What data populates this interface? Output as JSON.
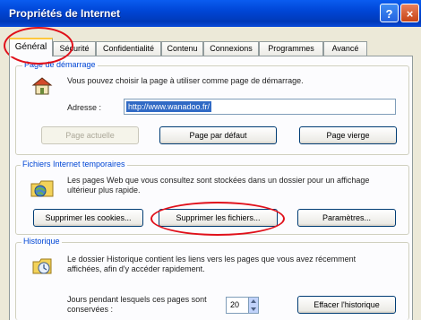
{
  "window": {
    "title": "Propriétés de Internet",
    "help_label": "?",
    "close_label": "×"
  },
  "tabs": [
    {
      "label": "Général",
      "active": true
    },
    {
      "label": "Sécurité"
    },
    {
      "label": "Confidentialité"
    },
    {
      "label": "Contenu"
    },
    {
      "label": "Connexions"
    },
    {
      "label": "Programmes"
    },
    {
      "label": "Avancé"
    }
  ],
  "homepage": {
    "legend": "Page de démarrage",
    "description": "Vous pouvez choisir la page à utiliser comme page de démarrage.",
    "address_label": "Adresse :",
    "address_value": "http://www.wanadoo.fr/",
    "btn_current": "Page actuelle",
    "btn_default": "Page par défaut",
    "btn_blank": "Page vierge"
  },
  "temp_files": {
    "legend": "Fichiers Internet temporaires",
    "description": "Les pages Web que vous consultez sont stockées dans un dossier pour un affichage ultérieur plus rapide.",
    "btn_cookies": "Supprimer les cookies...",
    "btn_files": "Supprimer les fichiers...",
    "btn_settings": "Paramètres..."
  },
  "history": {
    "legend": "Historique",
    "description": "Le dossier Historique contient les liens vers les pages que vous avez récemment affichées, afin d'y accéder rapidement.",
    "days_label": "Jours pendant lesquels ces pages sont conservées :",
    "days_value": "20",
    "btn_clear": "Effacer l'historique"
  },
  "colors": {
    "titlebar": "#0046d6",
    "annotation": "#e0101a",
    "group_legend": "#0046d5",
    "selection": "#316ac5"
  }
}
